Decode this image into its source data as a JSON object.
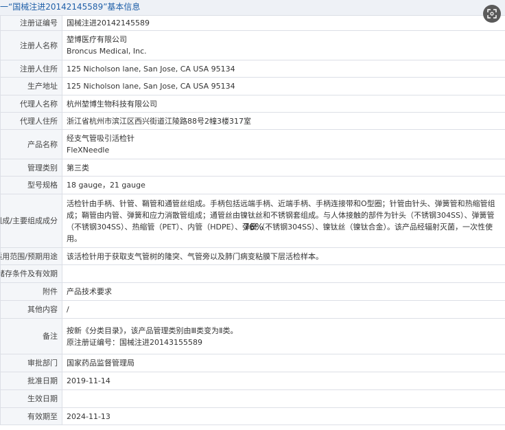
{
  "header": {
    "title": "一“国械注进20142145589”基本信息"
  },
  "overlay": {
    "zoom": "76%"
  },
  "rows": [
    {
      "label": "注册证编号",
      "lines": [
        "国械注进20142145589"
      ]
    },
    {
      "label": "注册人名称",
      "lines": [
        "堃博医疗有限公司",
        "Broncus Medical, Inc."
      ]
    },
    {
      "label": "注册人住所",
      "lines": [
        "125 Nicholson lane, San Jose, CA USA 95134"
      ]
    },
    {
      "label": "生产地址",
      "lines": [
        "125 Nicholson lane, San Jose, CA USA 95134"
      ]
    },
    {
      "label": "代理人名称",
      "lines": [
        "杭州堃博生物科技有限公司"
      ]
    },
    {
      "label": "代理人住所",
      "lines": [
        "浙江省杭州市滨江区西兴街道江陵路88号2幢3楼317室"
      ]
    },
    {
      "label": "产品名称",
      "lines": [
        "经支气管吸引活检针",
        "FleXNeedle"
      ]
    },
    {
      "label": "管理类别",
      "lines": [
        "第三类"
      ]
    },
    {
      "label": "型号规格",
      "lines": [
        "18 gauge，21 gauge"
      ]
    },
    {
      "label": "结构及组成/主要组成成分",
      "lines": [
        "活检针由手柄、针管、鞘管和通管丝组成。手柄包括远端手柄、近端手柄、手柄连接带和O型圈；针管由针头、弹簧管和热缩管组成；鞘管由内管、弹簧和应力消散管组成；通管丝由镍钛丝和不锈钢套组成。与人体接触的部件为针头（不锈钢304SS）、弹簧管（不锈钢304SS）、热缩管（PET）、内管（HDPE）、弹簧（不锈钢304SS）、镍钛丝（镍钛合金）。该产品经辐射灭菌，一次性使用。"
      ]
    },
    {
      "label": "适用范围/预期用途",
      "lines": [
        "该活检针用于获取支气管树的隆突、气管旁以及肺门病变粘膜下层活检样本。"
      ]
    },
    {
      "label": "产品储存条件及有效期",
      "lines": [
        ""
      ]
    },
    {
      "label": "附件",
      "lines": [
        "产品技术要求"
      ]
    },
    {
      "label": "其他内容",
      "lines": [
        "/"
      ]
    },
    {
      "label": "备注",
      "lines": [
        "按新《分类目录》，该产品管理类别由Ⅲ类变为Ⅱ类。",
        "原注册证编号：国械注进20143155589"
      ]
    },
    {
      "label": "审批部门",
      "lines": [
        "国家药品监督管理局"
      ]
    },
    {
      "label": "批准日期",
      "lines": [
        "2019-11-14"
      ]
    },
    {
      "label": "生效日期",
      "lines": [
        ""
      ]
    },
    {
      "label": "有效期至",
      "lines": [
        "2024-11-13"
      ]
    }
  ]
}
